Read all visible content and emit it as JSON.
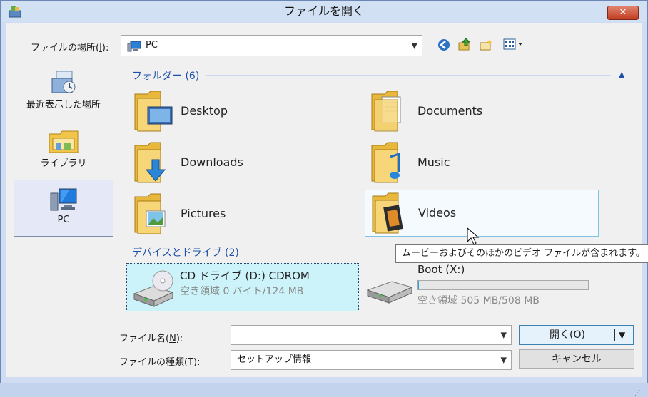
{
  "window": {
    "title": "ファイルを開く",
    "close_label": "✕"
  },
  "toolbar": {
    "location_label": "ファイルの場所(",
    "location_key": "I",
    "location_label_end": "):",
    "location_value": "PC",
    "icons": [
      "back-icon",
      "up-folder-icon",
      "new-folder-icon",
      "view-menu-icon"
    ]
  },
  "places": [
    {
      "label": "最近表示した場所",
      "icon": "recent-places-icon"
    },
    {
      "label": "ライブラリ",
      "icon": "libraries-icon"
    },
    {
      "label": "PC",
      "icon": "pc-icon",
      "selected": true
    }
  ],
  "folders_group": {
    "header": "フォルダー (6)"
  },
  "folders": [
    {
      "name": "Desktop",
      "icon": "desktop-folder-icon"
    },
    {
      "name": "Documents",
      "icon": "documents-folder-icon"
    },
    {
      "name": "Downloads",
      "icon": "downloads-folder-icon"
    },
    {
      "name": "Music",
      "icon": "music-folder-icon"
    },
    {
      "name": "Pictures",
      "icon": "pictures-folder-icon"
    },
    {
      "name": "Videos",
      "icon": "videos-folder-icon",
      "hover": true
    }
  ],
  "devices_group": {
    "header": "デバイスとドライブ (2)"
  },
  "drives": [
    {
      "name": "CD ドライブ (D:) CDROM",
      "free": "空き領域 0 バイト/124 MB",
      "selected": true,
      "icon": "cd-drive-icon"
    },
    {
      "name": "Boot (X:)",
      "free": "空き領域 505 MB/508 MB",
      "used_fraction": 0.006,
      "icon": "hard-drive-icon"
    }
  ],
  "tooltip": "ムービーおよびそのほかのビデオ ファイルが含まれます。",
  "filename": {
    "label": "ファイル名(",
    "key": "N",
    "label_end": "):",
    "value": ""
  },
  "filetype": {
    "label": "ファイルの種類(",
    "key": "T",
    "label_end": "):",
    "value": "セットアップ情報"
  },
  "buttons": {
    "open_label": "開く(",
    "open_key": "O",
    "open_label_end": ")",
    "cancel_label": "キャンセル"
  }
}
